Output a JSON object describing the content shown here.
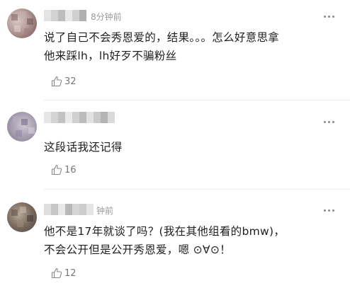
{
  "comments": [
    {
      "time": "8分钟前",
      "lines": [
        "说了自己不会秀恩爱的，结果。。。怎么好意思拿",
        "他来踩lh，lh好歹不骗粉丝"
      ],
      "likes": "32"
    },
    {
      "time": "",
      "lines": [
        "这段话我还记得"
      ],
      "likes": "16"
    },
    {
      "time": "钟前",
      "lines": [
        "他不是17年就谈了吗？(我在其他组看的bmw)，",
        "不会公开但是公开秀恩爱，嗯 ⊙∀⊙！"
      ],
      "likes": "12"
    }
  ],
  "icons": {
    "like": "thumbs-up-icon",
    "more": "more-dots-icon"
  },
  "colors": {
    "meta_text": "#9a9a9a",
    "body_text": "#202020",
    "divider": "#ececec"
  }
}
